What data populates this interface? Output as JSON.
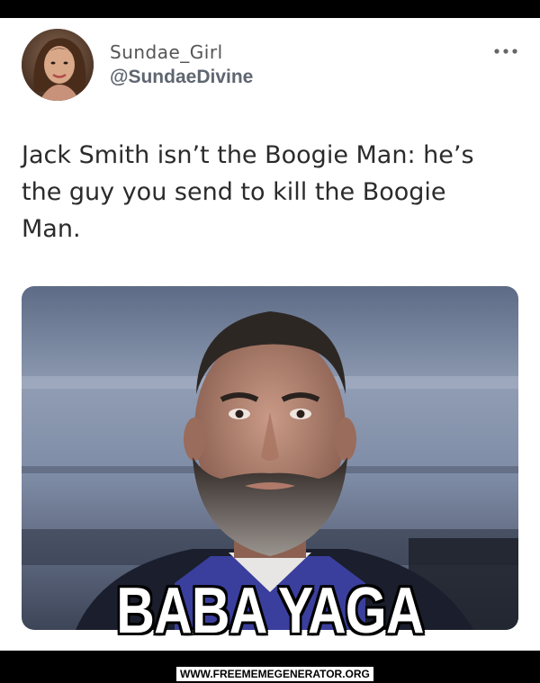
{
  "tweet": {
    "display_name": "Sundae_Girl",
    "handle": "@SundaeDivine",
    "text": "Jack Smith isn’t the Boogie Man: he’s the guy you send to kill the Boogie Man.",
    "menu_icon": "more-horizontal-icon"
  },
  "meme": {
    "caption": "BABA YAGA",
    "watermark": "WWW.FREEMEMEGENERATOR.ORG"
  },
  "colors": {
    "frame": "#000000",
    "card_background": "#ffffff",
    "text": "#2b2b2b",
    "handle": "#5f6670"
  }
}
